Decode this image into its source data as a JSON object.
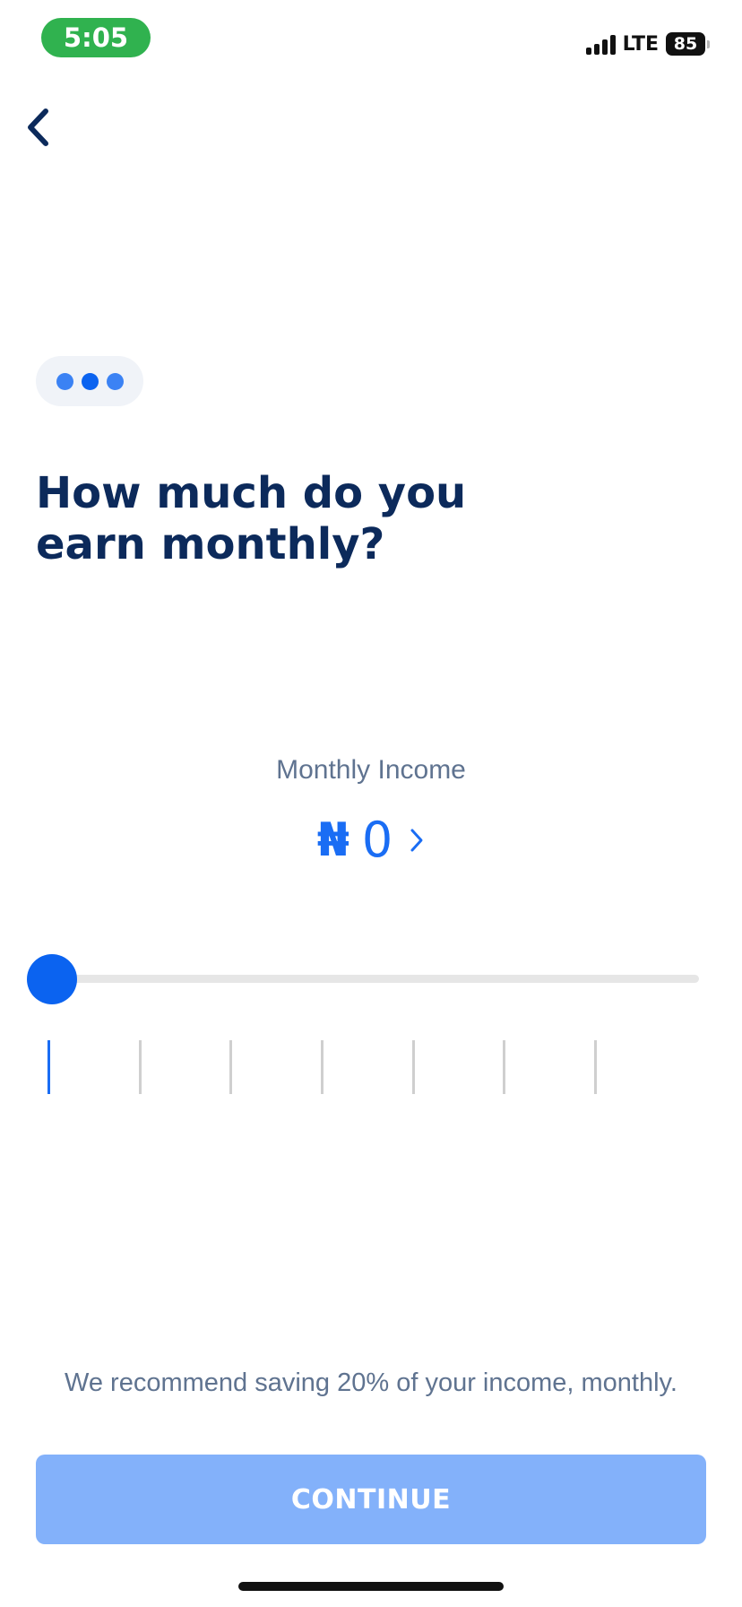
{
  "status_bar": {
    "time": "5:05",
    "network": "LTE",
    "battery": "85"
  },
  "header": {
    "back_icon": "chevron-left-icon"
  },
  "progress": {
    "steps": 3,
    "colors": [
      "#3b82f4",
      "#0b63f0",
      "#3b82f4"
    ]
  },
  "question": {
    "title": "How much do you earn monthly?"
  },
  "income": {
    "label": "Monthly Income",
    "currency_symbol": "₦",
    "value": "0",
    "chevron_icon": "chevron-right-icon"
  },
  "slider": {
    "value_fraction": 0,
    "tick_count": 7,
    "active_tick_index": 0,
    "accent_color": "#1a6df4",
    "tick_color": "#cfcfcf"
  },
  "recommendation": {
    "text": "We recommend saving 20% of your income, monthly."
  },
  "footer": {
    "continue_label": "CONTINUE"
  },
  "colors": {
    "title": "#0c2a5b",
    "accent": "#1a6df4",
    "button_disabled": "#83b1fa",
    "muted_text": "#5f7390"
  }
}
